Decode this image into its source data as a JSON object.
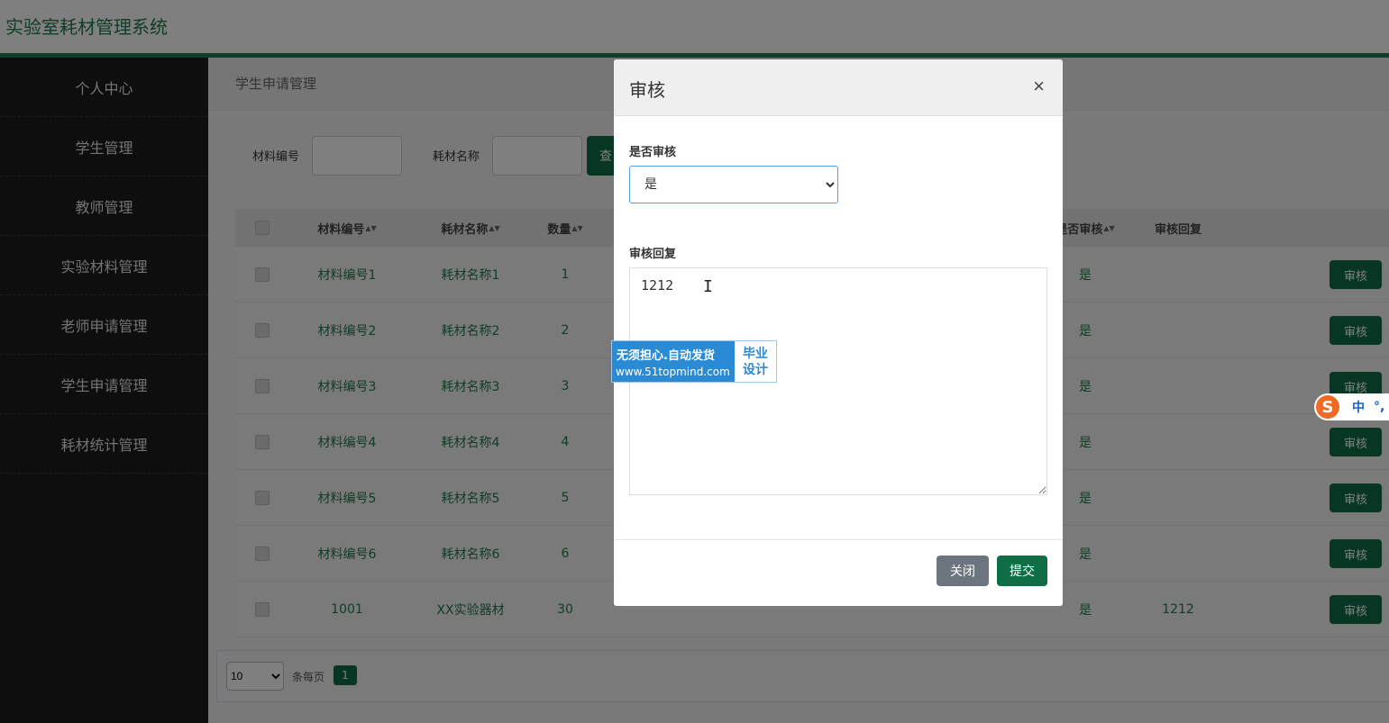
{
  "app": {
    "title": "实验室耗材管理系统"
  },
  "sidebar": {
    "items": [
      {
        "label": "个人中心"
      },
      {
        "label": "学生管理"
      },
      {
        "label": "教师管理"
      },
      {
        "label": "实验材料管理"
      },
      {
        "label": "老师申请管理"
      },
      {
        "label": "学生申请管理"
      },
      {
        "label": "耗材统计管理"
      }
    ]
  },
  "main": {
    "breadcrumb": "学生申请管理",
    "search": {
      "field1_label": "材料编号",
      "field2_label": "耗材名称",
      "button_label": "查"
    },
    "table": {
      "headers": {
        "material_no": "材料编号",
        "name": "耗材名称",
        "qty": "数量",
        "audited": "是否审核",
        "reply": "审核回复"
      },
      "action_label": "审核",
      "rows": [
        {
          "material_no": "材料编号1",
          "name": "耗材名称1",
          "qty": "1",
          "audited": "是",
          "reply": ""
        },
        {
          "material_no": "材料编号2",
          "name": "耗材名称2",
          "qty": "2",
          "audited": "是",
          "reply": ""
        },
        {
          "material_no": "材料编号3",
          "name": "耗材名称3",
          "qty": "3",
          "audited": "是",
          "reply": ""
        },
        {
          "material_no": "材料编号4",
          "name": "耗材名称4",
          "qty": "4",
          "audited": "是",
          "reply": ""
        },
        {
          "material_no": "材料编号5",
          "name": "耗材名称5",
          "qty": "5",
          "audited": "是",
          "reply": ""
        },
        {
          "material_no": "材料编号6",
          "name": "耗材名称6",
          "qty": "6",
          "audited": "是",
          "reply": ""
        },
        {
          "material_no": "1001",
          "name": "XX实验器材",
          "qty": "30",
          "audited": "是",
          "reply": "1212"
        }
      ]
    },
    "pagination": {
      "page_size": "10",
      "per_page_label": "条每页",
      "current_page": "1"
    }
  },
  "modal": {
    "title": "审核",
    "close_glyph": "×",
    "audit_label": "是否审核",
    "audit_value": "是",
    "reply_label": "审核回复",
    "reply_value": "1212",
    "close_button": "关闭",
    "submit_button": "提交"
  },
  "ad": {
    "line1": "无须担心.自动发货",
    "line2": "www.51topmind.com",
    "right_top": "毕业",
    "right_bottom": "设计"
  },
  "ime": {
    "logo": "S",
    "mode": "中",
    "punct": "°,"
  },
  "colors": {
    "brand_green": "#0f6e46",
    "header_accent": "#1e7a4a",
    "sidebar_bg": "#1c1c1c",
    "ad_blue": "#2a8ad4"
  }
}
